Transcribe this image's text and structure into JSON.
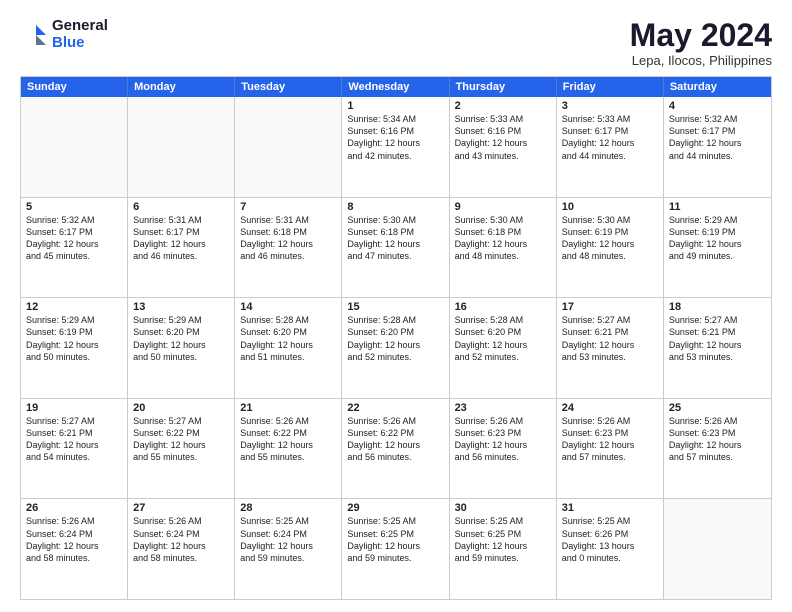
{
  "logo": {
    "general": "General",
    "blue": "Blue"
  },
  "title": "May 2024",
  "subtitle": "Lepa, Ilocos, Philippines",
  "days": [
    "Sunday",
    "Monday",
    "Tuesday",
    "Wednesday",
    "Thursday",
    "Friday",
    "Saturday"
  ],
  "weeks": [
    [
      {
        "num": "",
        "info": "",
        "empty": true
      },
      {
        "num": "",
        "info": "",
        "empty": true
      },
      {
        "num": "",
        "info": "",
        "empty": true
      },
      {
        "num": "1",
        "info": "Sunrise: 5:34 AM\nSunset: 6:16 PM\nDaylight: 12 hours\nand 42 minutes."
      },
      {
        "num": "2",
        "info": "Sunrise: 5:33 AM\nSunset: 6:16 PM\nDaylight: 12 hours\nand 43 minutes."
      },
      {
        "num": "3",
        "info": "Sunrise: 5:33 AM\nSunset: 6:17 PM\nDaylight: 12 hours\nand 44 minutes."
      },
      {
        "num": "4",
        "info": "Sunrise: 5:32 AM\nSunset: 6:17 PM\nDaylight: 12 hours\nand 44 minutes."
      }
    ],
    [
      {
        "num": "5",
        "info": "Sunrise: 5:32 AM\nSunset: 6:17 PM\nDaylight: 12 hours\nand 45 minutes."
      },
      {
        "num": "6",
        "info": "Sunrise: 5:31 AM\nSunset: 6:17 PM\nDaylight: 12 hours\nand 46 minutes."
      },
      {
        "num": "7",
        "info": "Sunrise: 5:31 AM\nSunset: 6:18 PM\nDaylight: 12 hours\nand 46 minutes."
      },
      {
        "num": "8",
        "info": "Sunrise: 5:30 AM\nSunset: 6:18 PM\nDaylight: 12 hours\nand 47 minutes."
      },
      {
        "num": "9",
        "info": "Sunrise: 5:30 AM\nSunset: 6:18 PM\nDaylight: 12 hours\nand 48 minutes."
      },
      {
        "num": "10",
        "info": "Sunrise: 5:30 AM\nSunset: 6:19 PM\nDaylight: 12 hours\nand 48 minutes."
      },
      {
        "num": "11",
        "info": "Sunrise: 5:29 AM\nSunset: 6:19 PM\nDaylight: 12 hours\nand 49 minutes."
      }
    ],
    [
      {
        "num": "12",
        "info": "Sunrise: 5:29 AM\nSunset: 6:19 PM\nDaylight: 12 hours\nand 50 minutes."
      },
      {
        "num": "13",
        "info": "Sunrise: 5:29 AM\nSunset: 6:20 PM\nDaylight: 12 hours\nand 50 minutes."
      },
      {
        "num": "14",
        "info": "Sunrise: 5:28 AM\nSunset: 6:20 PM\nDaylight: 12 hours\nand 51 minutes."
      },
      {
        "num": "15",
        "info": "Sunrise: 5:28 AM\nSunset: 6:20 PM\nDaylight: 12 hours\nand 52 minutes."
      },
      {
        "num": "16",
        "info": "Sunrise: 5:28 AM\nSunset: 6:20 PM\nDaylight: 12 hours\nand 52 minutes."
      },
      {
        "num": "17",
        "info": "Sunrise: 5:27 AM\nSunset: 6:21 PM\nDaylight: 12 hours\nand 53 minutes."
      },
      {
        "num": "18",
        "info": "Sunrise: 5:27 AM\nSunset: 6:21 PM\nDaylight: 12 hours\nand 53 minutes."
      }
    ],
    [
      {
        "num": "19",
        "info": "Sunrise: 5:27 AM\nSunset: 6:21 PM\nDaylight: 12 hours\nand 54 minutes."
      },
      {
        "num": "20",
        "info": "Sunrise: 5:27 AM\nSunset: 6:22 PM\nDaylight: 12 hours\nand 55 minutes."
      },
      {
        "num": "21",
        "info": "Sunrise: 5:26 AM\nSunset: 6:22 PM\nDaylight: 12 hours\nand 55 minutes."
      },
      {
        "num": "22",
        "info": "Sunrise: 5:26 AM\nSunset: 6:22 PM\nDaylight: 12 hours\nand 56 minutes."
      },
      {
        "num": "23",
        "info": "Sunrise: 5:26 AM\nSunset: 6:23 PM\nDaylight: 12 hours\nand 56 minutes."
      },
      {
        "num": "24",
        "info": "Sunrise: 5:26 AM\nSunset: 6:23 PM\nDaylight: 12 hours\nand 57 minutes."
      },
      {
        "num": "25",
        "info": "Sunrise: 5:26 AM\nSunset: 6:23 PM\nDaylight: 12 hours\nand 57 minutes."
      }
    ],
    [
      {
        "num": "26",
        "info": "Sunrise: 5:26 AM\nSunset: 6:24 PM\nDaylight: 12 hours\nand 58 minutes."
      },
      {
        "num": "27",
        "info": "Sunrise: 5:26 AM\nSunset: 6:24 PM\nDaylight: 12 hours\nand 58 minutes."
      },
      {
        "num": "28",
        "info": "Sunrise: 5:25 AM\nSunset: 6:24 PM\nDaylight: 12 hours\nand 59 minutes."
      },
      {
        "num": "29",
        "info": "Sunrise: 5:25 AM\nSunset: 6:25 PM\nDaylight: 12 hours\nand 59 minutes."
      },
      {
        "num": "30",
        "info": "Sunrise: 5:25 AM\nSunset: 6:25 PM\nDaylight: 12 hours\nand 59 minutes."
      },
      {
        "num": "31",
        "info": "Sunrise: 5:25 AM\nSunset: 6:26 PM\nDaylight: 13 hours\nand 0 minutes."
      },
      {
        "num": "",
        "info": "",
        "empty": true
      }
    ]
  ]
}
